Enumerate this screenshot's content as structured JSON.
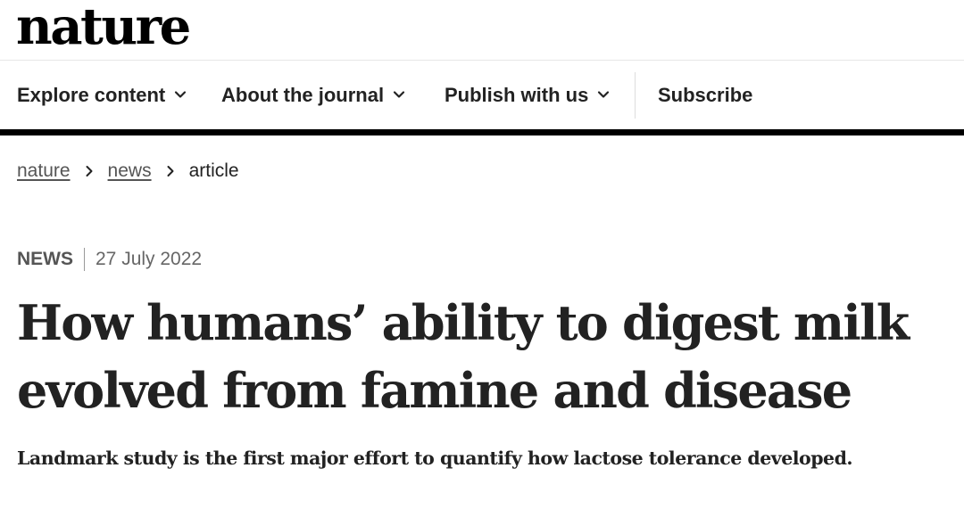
{
  "header": {
    "logo_text": "nature"
  },
  "nav": {
    "items": [
      {
        "label": "Explore content",
        "has_dropdown": true
      },
      {
        "label": "About the journal",
        "has_dropdown": true
      },
      {
        "label": "Publish with us",
        "has_dropdown": true
      },
      {
        "label": "Subscribe",
        "has_dropdown": false
      }
    ]
  },
  "breadcrumb": {
    "items": [
      {
        "label": "nature",
        "link": true
      },
      {
        "label": "news",
        "link": true
      },
      {
        "label": "article",
        "link": false
      }
    ]
  },
  "article": {
    "type": "NEWS",
    "date": "27 July 2022",
    "title": "How humans’ ability to digest milk evolved from famine and disease",
    "standfirst": "Landmark study is the first major effort to quantify how lactose tolerance developed."
  },
  "colors": {
    "text": "#222222",
    "rule": "#000000",
    "muted": "#555555"
  },
  "icons": {
    "dropdown": "chevron-down-icon",
    "breadcrumb_separator": "chevron-right-icon"
  }
}
